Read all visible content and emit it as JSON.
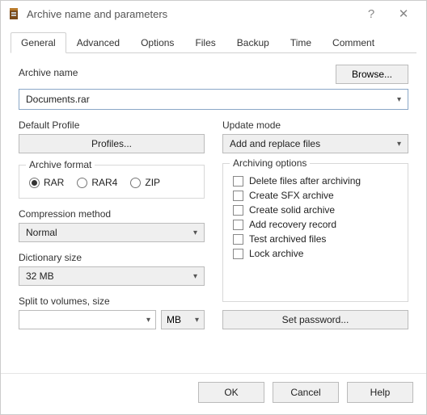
{
  "title": "Archive name and parameters",
  "tabs": [
    "General",
    "Advanced",
    "Options",
    "Files",
    "Backup",
    "Time",
    "Comment"
  ],
  "activeTab": 0,
  "labels": {
    "archiveName": "Archive name",
    "browse": "Browse...",
    "defaultProfile": "Default Profile",
    "profiles": "Profiles...",
    "updateMode": "Update mode",
    "archiveFormat": "Archive format",
    "compressionMethod": "Compression method",
    "dictionarySize": "Dictionary size",
    "splitVolumes": "Split to volumes, size",
    "archivingOptions": "Archiving options",
    "setPassword": "Set password...",
    "ok": "OK",
    "cancel": "Cancel",
    "help": "Help"
  },
  "values": {
    "archiveName": "Documents.rar",
    "updateMode": "Add and replace files",
    "compressionMethod": "Normal",
    "dictionarySize": "32 MB",
    "splitSize": "",
    "splitUnit": "MB"
  },
  "formats": [
    {
      "label": "RAR",
      "selected": true
    },
    {
      "label": "RAR4",
      "selected": false
    },
    {
      "label": "ZIP",
      "selected": false
    }
  ],
  "options": [
    "Delete files after archiving",
    "Create SFX archive",
    "Create solid archive",
    "Add recovery record",
    "Test archived files",
    "Lock archive"
  ]
}
